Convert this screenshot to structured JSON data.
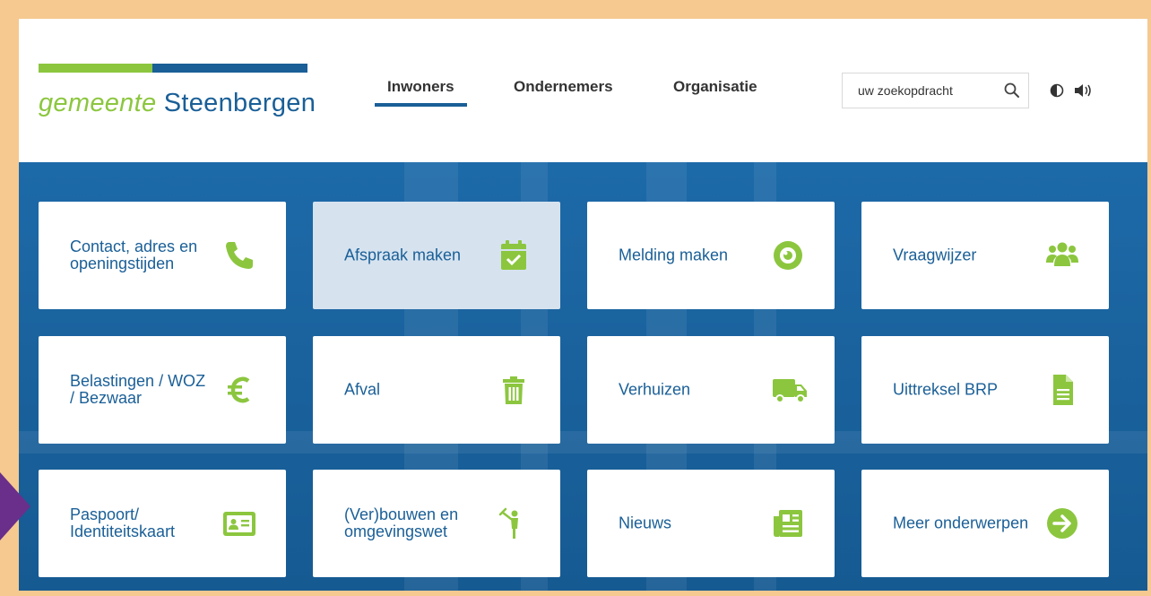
{
  "site": {
    "logo_word1": "gemeente",
    "logo_word2": "Steenbergen"
  },
  "nav": {
    "items": [
      {
        "label": "Inwoners",
        "active": true
      },
      {
        "label": "Ondernemers",
        "active": false
      },
      {
        "label": "Organisatie",
        "active": false
      }
    ]
  },
  "search": {
    "placeholder": "uw zoekopdracht",
    "icon": "search-icon"
  },
  "tools": {
    "contrast_icon": "contrast-icon",
    "speak_icon": "speaker-icon"
  },
  "colors": {
    "brand_green": "#8cc63f",
    "brand_blue": "#1a5f97",
    "frame": "#f5c990",
    "marker": "#6a2f8a"
  },
  "tiles": [
    {
      "label": "Contact, adres en openingstijden",
      "icon": "phone-icon",
      "highlighted": false
    },
    {
      "label": "Afspraak maken",
      "icon": "calendar-check-icon",
      "highlighted": true
    },
    {
      "label": "Melding maken",
      "icon": "eye-icon",
      "highlighted": false
    },
    {
      "label": "Vraagwijzer",
      "icon": "users-icon",
      "highlighted": false
    },
    {
      "label": "Belastingen / WOZ / Bezwaar",
      "icon": "euro-icon",
      "highlighted": false
    },
    {
      "label": "Afval",
      "icon": "trash-icon",
      "highlighted": false
    },
    {
      "label": "Verhuizen",
      "icon": "truck-icon",
      "highlighted": false
    },
    {
      "label": "Uittreksel BRP",
      "icon": "document-icon",
      "highlighted": false
    },
    {
      "label": "Paspoort/ Identiteitskaart",
      "icon": "id-card-icon",
      "highlighted": false
    },
    {
      "label": "(Ver)bouwen en omgevingswet",
      "icon": "builder-icon",
      "highlighted": false
    },
    {
      "label": "Nieuws",
      "icon": "newspaper-icon",
      "highlighted": false
    },
    {
      "label": "Meer onderwerpen",
      "icon": "arrow-right-circle-icon",
      "highlighted": false
    }
  ]
}
